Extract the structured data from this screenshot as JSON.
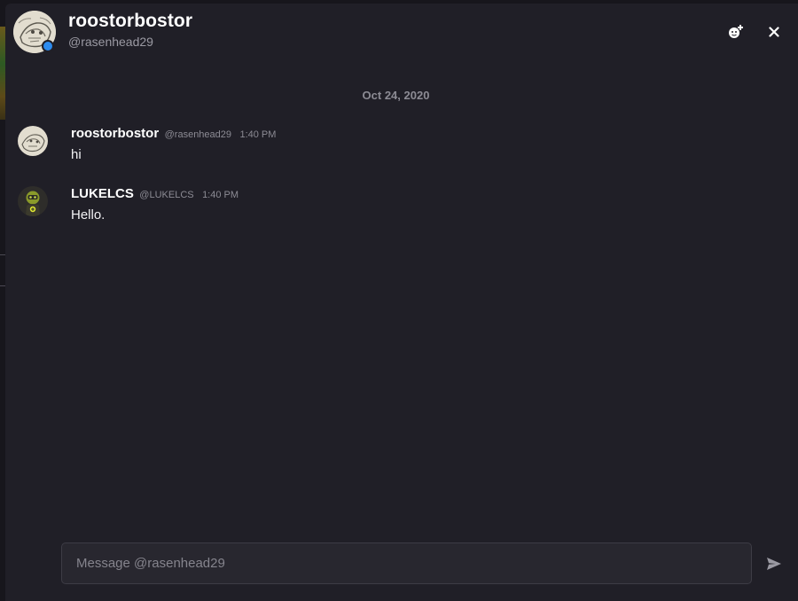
{
  "header": {
    "name": "roostorbostor",
    "handle": "@rasenhead29",
    "status": "online",
    "status_color": "#2d8cf0",
    "actions": [
      {
        "icon": "add-friend-icon"
      },
      {
        "icon": "close-icon"
      }
    ]
  },
  "conversation": {
    "date_divider": "Oct 24, 2020",
    "messages": [
      {
        "author": "roostorbostor",
        "handle": "@rasenhead29",
        "time": "1:40 PM",
        "text": "hi",
        "avatar_icon": "sketch-avatar"
      },
      {
        "author": "LUKELCS",
        "handle": "@LUKELCS",
        "time": "1:40 PM",
        "text": "Hello.",
        "avatar_icon": "hazmat-avatar"
      }
    ]
  },
  "composer": {
    "placeholder": "Message @rasenhead29",
    "value": "",
    "send_icon": "send-icon"
  },
  "colors": {
    "background": "#201f27",
    "accent": "#2d8cf0",
    "text_primary": "#ffffff",
    "text_muted": "#8c8b94"
  }
}
